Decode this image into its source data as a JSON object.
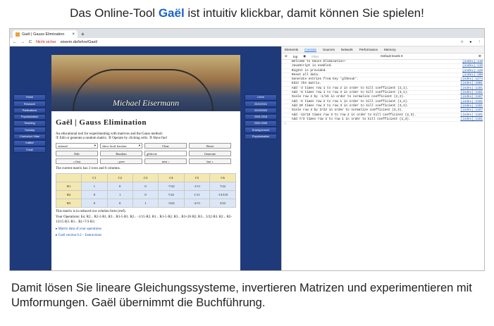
{
  "caption_top": {
    "before": "Das Online-Tool ",
    "bold": "Gaël",
    "after": " ist intuitiv klickbar, damit können Sie spielen!"
  },
  "caption_bottom": "Damit lösen Sie lineare Gleichungssysteme, invertieren Matrizen und experimentieren mit Umformungen. Gaël übernimmt die Buchführung.",
  "browser": {
    "tab_title": "Gaël | Gauss Elimination",
    "security": "Nicht sicher",
    "url": "eiserm.de/lehre/Gael/"
  },
  "nav_left": [
    "Home",
    "Research",
    "Publications",
    "Popularization",
    "Teaching",
    "Tuesday",
    "Curriculum Vitae",
    "Institut",
    "Email"
  ],
  "nav_right": [
    "Lehre",
    "2020/2021",
    "2019/2020",
    "2005-2018",
    "2000-2006",
    "Enseignement",
    "Popularisation"
  ],
  "site": {
    "author": "Michael Eisermann",
    "heading": "Gaël | Gauss Elimination",
    "intro": "An educational tool for experimenting with matrices and the Gauss method:",
    "intro2": "① Edit or generate a random matrix. ② Operate by clicking cells. ③ Have fun!",
    "sel1": "rational",
    "sel2": "show local fraction",
    "clear": "Clear",
    "reset": "Reset",
    "edit": "Edit",
    "random": "Random",
    "seed": "glhkvuk",
    "generate": "Generate",
    "first": "« first",
    "prev": "‹ prev",
    "next": "next ›",
    "last": "last »",
    "matrix_info": "The current matrix has 3 rows and 6 columns.",
    "headers": [
      "",
      "C1",
      "C2",
      "C3",
      "C4",
      "C5",
      "C6"
    ],
    "rows": [
      [
        "R1",
        "1",
        "0",
        "0",
        "-7/22",
        "-1/11",
        "7/22"
      ],
      [
        "R2",
        "0",
        "1",
        "0",
        "7/22",
        "1/11",
        "-13/110"
      ],
      [
        "R3",
        "0",
        "0",
        "1",
        "-3/22",
        "-2/11",
        "3/22"
      ]
    ],
    "echelon": "This matrix is in reduced row echelon form (rref).",
    "ops": "Your Operations: Ini. R2←R2-3·R1. R3←R3-5·R1. R2←-1/15·R2. R1←R1-5·R2. R3←R3+20·R2. R3←3/22·R3. R2←R2-13/15·R3. R1←R1+7/3·R3.",
    "link1": "▸ Matrix data of your operations",
    "link2": "▸ Gaël version 0.2 – Instructions"
  },
  "devtools": {
    "tabs": [
      "Elements",
      "Console",
      "Sources",
      "Network",
      "Performance",
      "Memory"
    ],
    "context": "top",
    "filter": "Filter",
    "levels": "Default levels ▾",
    "lines": [
      [
        "Welcome to Gauss Elimination!",
        "(index):118"
      ],
      [
        "JavaScript is enabled.",
        "(index):119"
      ],
      [
        "BigInt is provided.",
        "(index):128"
      ],
      [
        "Reset all data.",
        "(index):198"
      ],
      [
        "Generate entries from key 'glhkvuk'.",
        "(index):1274"
      ],
      [
        "Edit the matrix.",
        "(index):1001"
      ],
      [
        "Add -3 times row 1 to row 2 in order to kill coefficient (2,1).",
        "(index):1181"
      ],
      [
        "Add -5 times row 1 to row 3 in order to kill coefficient (3,1).",
        "(index):1181"
      ],
      [
        "Scale row 2 by -1/15 in order to normalize coefficient (2,2).",
        "(index):1187"
      ],
      [
        "Add -5 times row 2 to row 1 in order to kill coefficient (1,2).",
        "(index):1181"
      ],
      [
        "Add 20 times row 2 to row 3 in order to kill coefficient (3,2).",
        "(index):1181"
      ],
      [
        "Scale row 3 by 3/22 in order to normalize coefficient (3,3).",
        "(index):1187"
      ],
      [
        "Add -13/15 times row 3 to row 2 in order to kill coefficient (2,3).",
        "(index):1181"
      ],
      [
        "Add 7/3 times row 3 to row 1 in order to kill coefficient (1,3).",
        "(index):1181"
      ]
    ]
  }
}
